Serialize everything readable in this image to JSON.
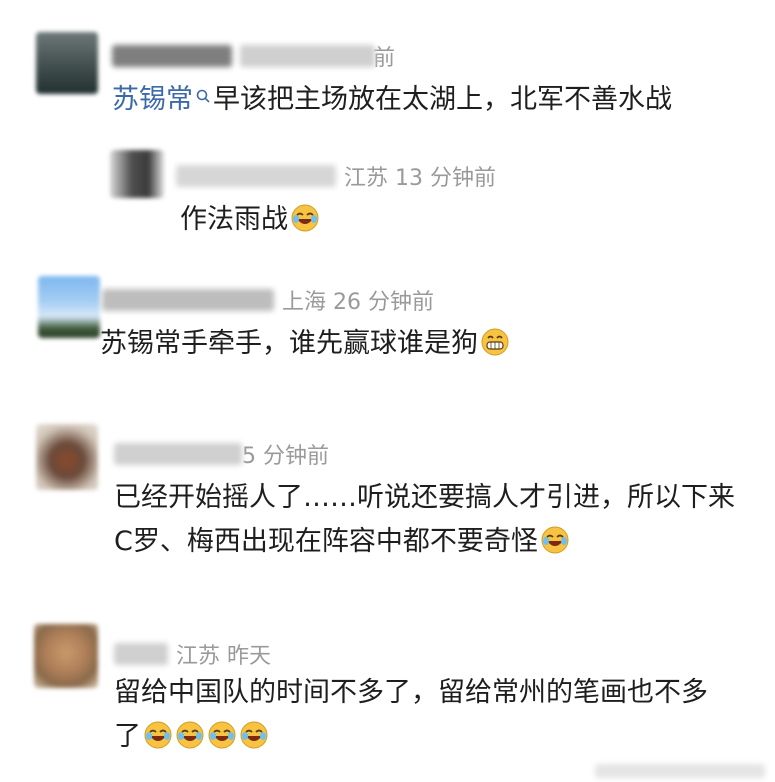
{
  "comments": [
    {
      "meta": "前",
      "topic": "苏锡常",
      "text": "早该把主场放在太湖上，北军不善水战",
      "emoji_count": 0
    },
    {
      "meta": "江苏 13 分钟前",
      "text": "作法雨战",
      "emoji": "laugh-cry-emoji"
    },
    {
      "meta": "上海 26 分钟前",
      "text": "苏锡常手牵手，谁先赢球谁是狗",
      "emoji": "grin-emoji"
    },
    {
      "meta": "5 分钟前",
      "line1": "已经开始摇人了……听说还要搞人才引进，所以下来",
      "line2": "C罗、梅西出现在阵容中都不要奇怪",
      "emoji": "laugh-cry-emoji"
    },
    {
      "meta": "江苏  昨天",
      "line1": "留给中国队的时间不多了，留给常州的笔画也不多",
      "line2": "了",
      "emoji": "laugh-cry-emoji",
      "emoji_count": 4
    }
  ],
  "colors": {
    "topic": "#3b6aa8",
    "meta": "#9a9a9a",
    "text": "#1e1e1e",
    "emoji": "#f6c343"
  }
}
